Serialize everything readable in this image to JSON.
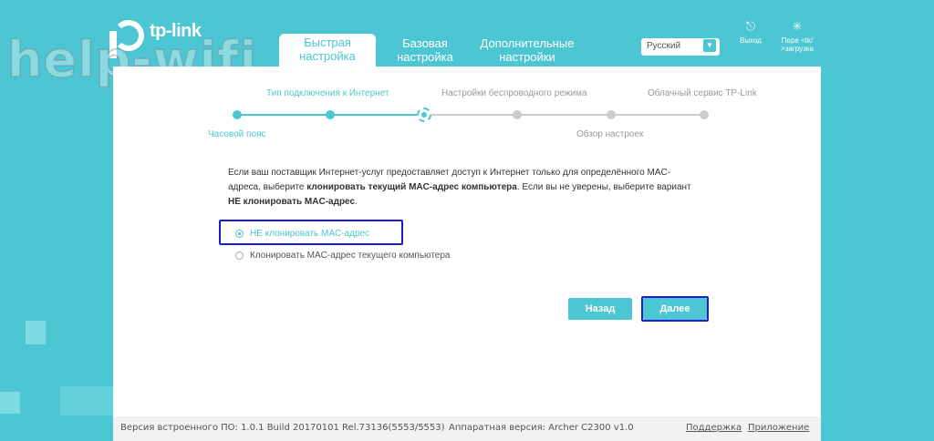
{
  "watermark": "help-wifi.ru",
  "brand": {
    "name": "tp-link"
  },
  "tabs": [
    {
      "label": "Быстрая настройка",
      "active": true
    },
    {
      "label": "Базовая настройка",
      "active": false
    },
    {
      "label": "Дополнительные настройки",
      "active": false
    }
  ],
  "language": {
    "selected": "Русский"
  },
  "header_actions": {
    "logout": "Выход",
    "reboot": "Пере <tk/ >загрузка"
  },
  "wizard": {
    "steps_top": [
      "Тип подключения к Интернет",
      "Настройки беспроводного режима",
      "Облачный сервис TP-Link"
    ],
    "steps_bottom": [
      "Часовой пояс",
      "Обзор настроек"
    ],
    "current_step_index": 2,
    "total_steps": 6
  },
  "description": {
    "part1": "Если ваш поставщик Интернет-услуг предоставляет доступ к Интернет только для определённого MAC-адреса, выберите ",
    "bold1": "клонировать текущий MAC-адрес компьютера",
    "part2": ". Если вы не уверены, выберите вариант ",
    "bold2": "НЕ клонировать MAC-адрес",
    "part3": "."
  },
  "options": [
    {
      "label": "НЕ клонировать MAC-адрес",
      "checked": true
    },
    {
      "label": "Клонировать MAC-адрес текущего компьютера",
      "checked": false
    }
  ],
  "buttons": {
    "back": "Назад",
    "next": "Далее"
  },
  "footer": {
    "firmware": "Версия встроенного ПО: 1.0.1 Build 20170101 Rel.73136(5553/5553)",
    "hardware": "Аппаратная версия: Archer C2300 v1.0",
    "support": "Поддержка",
    "app": "Приложение"
  },
  "colors": {
    "accent": "#4bc6d2",
    "highlight": "#1c1cd6"
  }
}
